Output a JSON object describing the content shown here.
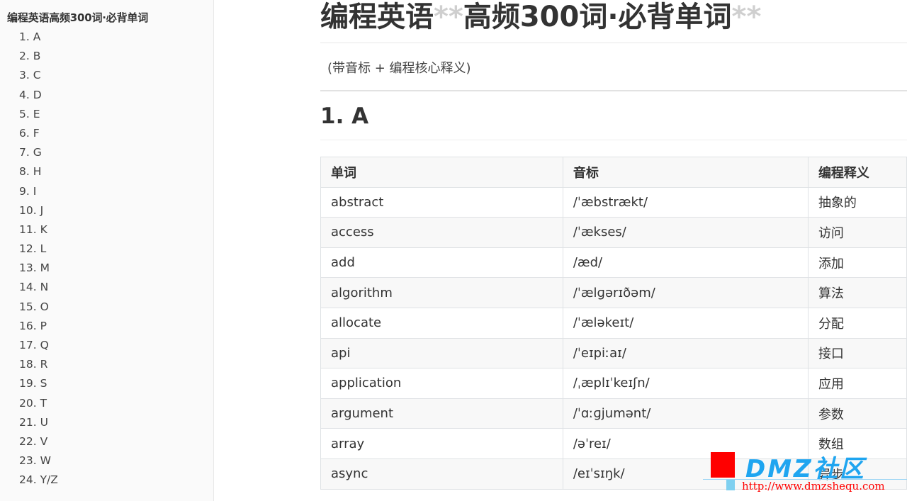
{
  "sidebar": {
    "title": "编程英语高频300词·必背单词",
    "items": [
      "1. A",
      "2. B",
      "3. C",
      "4. D",
      "5. E",
      "6. F",
      "7. G",
      "8. H",
      "9. I",
      "10. J",
      "11. K",
      "12. L",
      "13. M",
      "14. N",
      "15. O",
      "16. P",
      "17. Q",
      "18. R",
      "19. S",
      "20. T",
      "21. U",
      "22. V",
      "23. W",
      "24. Y/Z"
    ]
  },
  "main": {
    "title_part1": "编程英语",
    "title_stars1": "**",
    "title_part2": "高频300词·必背单词",
    "title_stars2": "**",
    "subtitle": "(带音标 + 编程核心释义)",
    "section_heading": "1. A",
    "table": {
      "headers": [
        "单词",
        "音标",
        "编程释义"
      ],
      "rows": [
        [
          "abstract",
          "/ˈæbstrækt/",
          "抽象的"
        ],
        [
          "access",
          "/ˈækses/",
          "访问"
        ],
        [
          "add",
          "/æd/",
          "添加"
        ],
        [
          "algorithm",
          "/ˈælɡərɪðəm/",
          "算法"
        ],
        [
          "allocate",
          "/ˈæləkeɪt/",
          "分配"
        ],
        [
          "api",
          "/ˈeɪpiːaɪ/",
          "接口"
        ],
        [
          "application",
          "/ˌæplɪˈkeɪʃn/",
          "应用"
        ],
        [
          "argument",
          "/ˈɑːɡjumənt/",
          "参数"
        ],
        [
          "array",
          "/əˈreɪ/",
          "数组"
        ],
        [
          "async",
          "/eɪˈsɪŋk/",
          "异步"
        ]
      ]
    }
  },
  "watermark": {
    "brand": "DMZ社区",
    "url": "http://www.dmzshequ.com"
  }
}
